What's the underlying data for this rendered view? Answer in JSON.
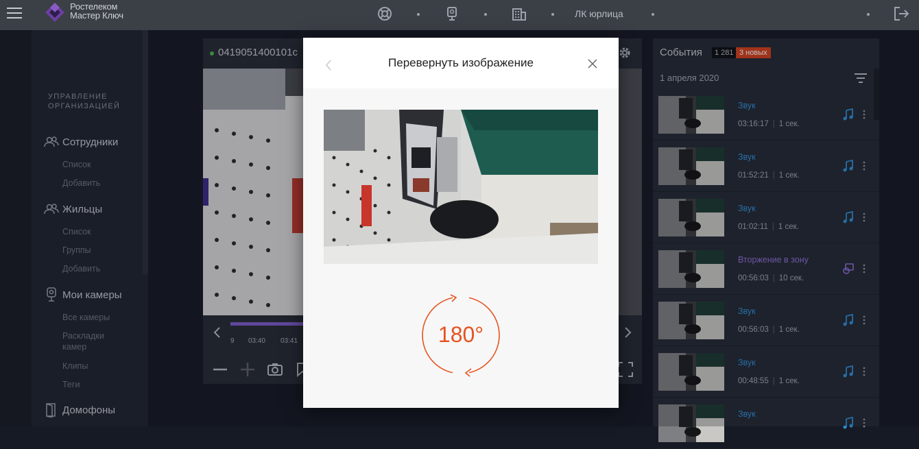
{
  "header": {
    "brand_line1": "Ростелеком",
    "brand_line2": "Мастер Ключ",
    "org_label": "ЛК юрлица"
  },
  "sidebar": {
    "heading": "Управление организацией",
    "sections": [
      {
        "label": "Сотрудники",
        "links": [
          "Список",
          "Добавить"
        ]
      },
      {
        "label": "Жильцы",
        "links": [
          "Список",
          "Группы",
          "Добавить"
        ]
      },
      {
        "label": "Мои камеры",
        "links": [
          "Все камеры",
          "Раскладки камер",
          "Клипы",
          "Теги"
        ]
      },
      {
        "label": "Домофоны",
        "links": []
      }
    ]
  },
  "camera": {
    "id": "0419051400101c",
    "timeline_labels": [
      "9",
      "03:40",
      "03:41"
    ]
  },
  "events": {
    "title": "События",
    "count": "1 281",
    "new_badge": "3 новых",
    "date": "1 апреля 2020",
    "items": [
      {
        "type": "Звук",
        "time": "03:16:17",
        "duration": "1 сек.",
        "kind": "sound"
      },
      {
        "type": "Звук",
        "time": "01:52:21",
        "duration": "1 сек.",
        "kind": "sound"
      },
      {
        "type": "Звук",
        "time": "01:02:11",
        "duration": "1 сек.",
        "kind": "sound"
      },
      {
        "type": "Вторжение в зону",
        "time": "00:56:03",
        "duration": "10 сек.",
        "kind": "intrusion"
      },
      {
        "type": "Звук",
        "time": "00:56:03",
        "duration": "1 сек.",
        "kind": "sound"
      },
      {
        "type": "Звук",
        "time": "00:48:55",
        "duration": "1 сек.",
        "kind": "sound"
      },
      {
        "type": "Звук",
        "time": "",
        "duration": "",
        "kind": "sound"
      }
    ]
  },
  "modal": {
    "title": "Перевернуть изображение",
    "rotation_label": "180°"
  },
  "colors": {
    "accent_orange": "#e5531e",
    "sound_blue": "#2f8fd8",
    "intrusion_purple": "#8e6fd6",
    "new_badge": "#d2401e"
  }
}
